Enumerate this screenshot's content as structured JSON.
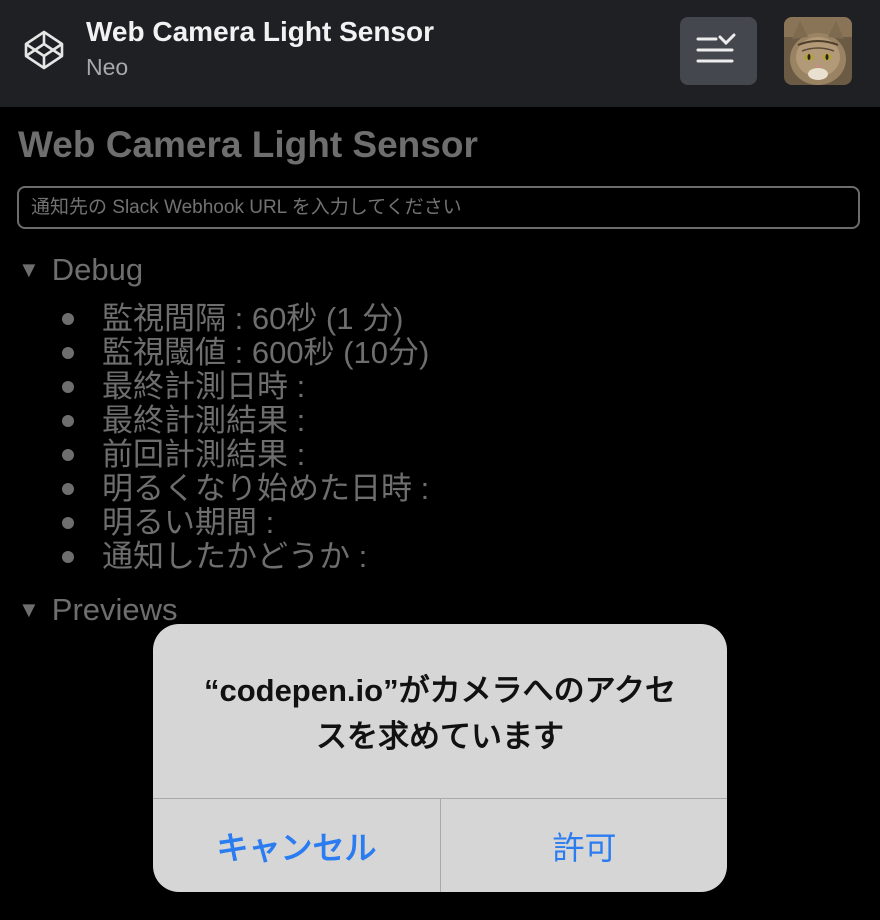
{
  "header": {
    "title": "Web Camera Light Sensor",
    "user": "Neo",
    "menu_icon": "list-collapse-icon",
    "logo_icon": "codepen-logo-icon"
  },
  "page": {
    "title": "Web Camera Light Sensor",
    "webhook_placeholder": "通知先の Slack Webhook URL を入力してください",
    "webhook_value": ""
  },
  "debug": {
    "label": "Debug",
    "items": [
      "監視間隔 : 60秒 (1 分)",
      "監視閾値 : 600秒 (10分)",
      "最終計測日時 :",
      "最終計測結果 :",
      "前回計測結果 :",
      "明るくなり始めた日時 :",
      "明るい期間 :",
      "通知したかどうか :"
    ]
  },
  "previews": {
    "label": "Previews"
  },
  "dialog": {
    "message": "“codepen.io”がカメラへのアクセスを求めています",
    "cancel": "キャンセル",
    "allow": "許可",
    "button_color": "#2b7cf0"
  }
}
